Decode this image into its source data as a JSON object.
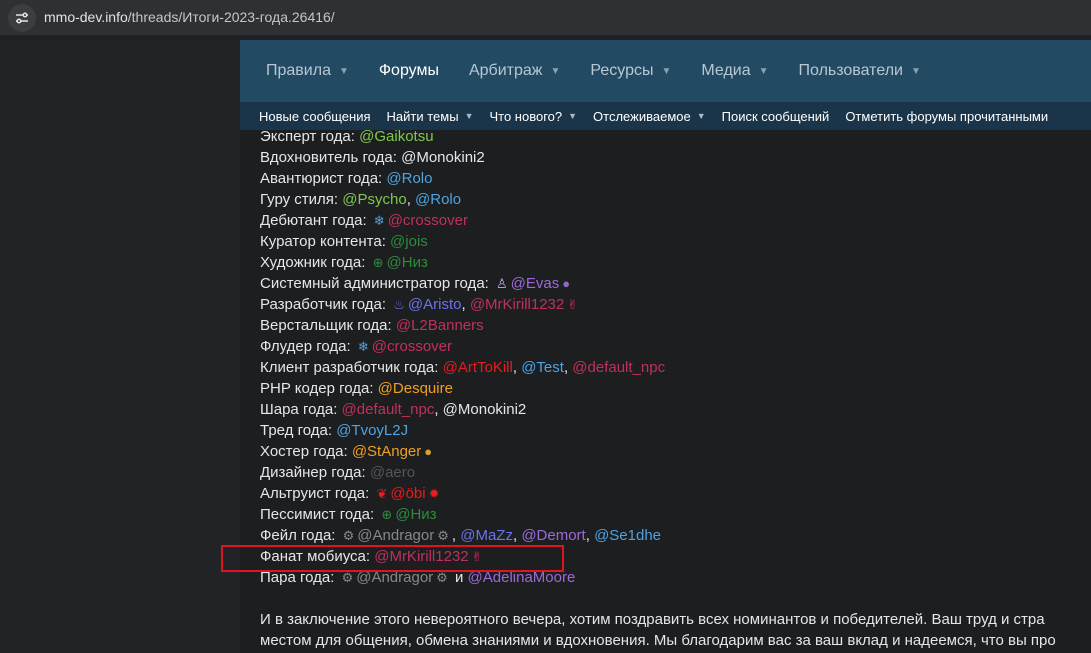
{
  "browser": {
    "url_host": "mmo-dev.info",
    "url_path": "/threads/Итоги-2023-года.26416/"
  },
  "nav": {
    "tabs": [
      {
        "label": "Правила",
        "dropdown": true
      },
      {
        "label": "Форумы",
        "dropdown": false,
        "active": true
      },
      {
        "label": "Арбитраж",
        "dropdown": true
      },
      {
        "label": "Ресурсы",
        "dropdown": true
      },
      {
        "label": "Медиа",
        "dropdown": true
      },
      {
        "label": "Пользователи",
        "dropdown": true
      }
    ],
    "subtabs": [
      {
        "label": "Новые сообщения",
        "dropdown": false
      },
      {
        "label": "Найти темы",
        "dropdown": true
      },
      {
        "label": "Что нового?",
        "dropdown": true
      },
      {
        "label": "Отслеживаемое",
        "dropdown": true
      },
      {
        "label": "Поиск сообщений",
        "dropdown": false
      },
      {
        "label": "Отметить форумы прочитанными",
        "dropdown": false
      }
    ]
  },
  "colors": {
    "green": "#7ec850",
    "blue": "#4ea3e3",
    "crimson": "#c0305c",
    "darkgreen": "#2e8b3c",
    "purple": "#9b6ad8",
    "indigo": "#6a74e8",
    "red": "#e81c1c",
    "orange": "#f0a020",
    "gray": "#555555",
    "white": "#e6e6e6",
    "highlight": "#e0141e"
  },
  "awards": [
    {
      "label": "Эксперт года:",
      "users": [
        {
          "name": "@Gaikotsu",
          "color": "#7ec850"
        }
      ]
    },
    {
      "label": "Вдохновитель года:",
      "users": [
        {
          "name": "@Monokini2",
          "color": "#e6e6e6"
        }
      ]
    },
    {
      "label": "Авантюрист года:",
      "users": [
        {
          "name": "@Rolo",
          "color": "#4ea3e3"
        }
      ]
    },
    {
      "label": "Гуру стиля:",
      "users": [
        {
          "name": "@Psycho",
          "color": "#7ec850",
          "sep": ", "
        },
        {
          "name": "@Rolo",
          "color": "#4ea3e3"
        }
      ]
    },
    {
      "label": "Дебютант года:",
      "users": [
        {
          "name": "@crossover",
          "color": "#c0305c",
          "pre_icon": "snowflake-icon"
        }
      ]
    },
    {
      "label": "Куратор контента:",
      "users": [
        {
          "name": "@jois",
          "color": "#2e8b3c"
        }
      ]
    },
    {
      "label": "Художник года:",
      "users": [
        {
          "name": "@Низ",
          "color": "#2e8b3c",
          "pre_icon": "arrow-down-circle-icon"
        }
      ]
    },
    {
      "label": "Системный администратор года:",
      "users": [
        {
          "name": "@Evas",
          "color": "#9b6ad8",
          "pre_icon": "linux-icon",
          "post_icon": "verified-badge-icon"
        }
      ]
    },
    {
      "label": "Разработчик года:",
      "users": [
        {
          "name": "@Aristo",
          "color": "#6a74e8",
          "pre_icon": "java-icon",
          "sep": ", "
        },
        {
          "name": "@MrKirill1232",
          "color": "#c0305c",
          "post_icon": "crab-icon"
        }
      ]
    },
    {
      "label": "Верстальщик года:",
      "users": [
        {
          "name": "@L2Banners",
          "color": "#c0305c"
        }
      ]
    },
    {
      "label": "Флудер года:",
      "users": [
        {
          "name": "@crossover",
          "color": "#c0305c",
          "pre_icon": "snowflake-icon"
        }
      ]
    },
    {
      "label": "Клиент разработчик года:",
      "users": [
        {
          "name": "@ArtToKill",
          "color": "#e81c1c",
          "sep": ", "
        },
        {
          "name": "@Test",
          "color": "#4ea3e3",
          "sep": ", "
        },
        {
          "name": "@default_npc",
          "color": "#c0305c"
        }
      ]
    },
    {
      "label": "PHP кодер года:",
      "users": [
        {
          "name": "@Desquire",
          "color": "#f0a020"
        }
      ]
    },
    {
      "label": "Шара года:",
      "users": [
        {
          "name": "@default_npc",
          "color": "#c0305c",
          "sep": ", "
        },
        {
          "name": "@Monokini2",
          "color": "#e6e6e6"
        }
      ]
    },
    {
      "label": "Тред года:",
      "users": [
        {
          "name": "@TvoyL2J",
          "color": "#4ea3e3"
        }
      ]
    },
    {
      "label": "Хостер года:",
      "users": [
        {
          "name": "@StAnger",
          "color": "#f0a020",
          "post_icon": "gold-badge-icon"
        }
      ]
    },
    {
      "label": "Дизайнер года:",
      "users": [
        {
          "name": "@aero",
          "color": "#555555"
        }
      ]
    },
    {
      "label": "Альтруист года:",
      "users": [
        {
          "name": "@öbi",
          "color": "#e81c1c",
          "pre_icon": "heart-flag-icon",
          "post_icon": "red-star-icon"
        }
      ]
    },
    {
      "label": "Пессимист года:",
      "users": [
        {
          "name": "@Низ",
          "color": "#2e8b3c",
          "pre_icon": "arrow-down-circle-icon"
        }
      ]
    },
    {
      "label": "Фейл года:",
      "users": [
        {
          "name": "@Andragor",
          "color": "#888888",
          "pre_icon": "gear-icon",
          "post_icon": "gear-icon",
          "sep": ", "
        },
        {
          "name": "@MaZz",
          "color": "#6a74e8",
          "sep": ", "
        },
        {
          "name": "@Demort",
          "color": "#9b6ad8",
          "sep": ", "
        },
        {
          "name": "@Se1dhe",
          "color": "#4ea3e3"
        }
      ]
    },
    {
      "label": "Фанат мобиуса:",
      "users": [
        {
          "name": "@MrKirill1232",
          "color": "#c0305c",
          "post_icon": "crab-icon"
        }
      ],
      "highlighted": true
    },
    {
      "label": "Пара года:",
      "users": [
        {
          "name": "@Andragor",
          "color": "#888888",
          "pre_icon": "gear-icon",
          "post_icon": "gear-icon",
          "sep": " и "
        },
        {
          "name": "@AdelinaMoore",
          "color": "#9b6ad8"
        }
      ]
    }
  ],
  "closing": {
    "line1": "И в заключение этого невероятного вечера, хотим поздравить всех номинантов и победителей. Ваш труд и стра",
    "line2": "местом для общения, обмена знаниями и вдохновения. Мы благодарим вас за ваш вклад и надеемся, что вы про"
  }
}
